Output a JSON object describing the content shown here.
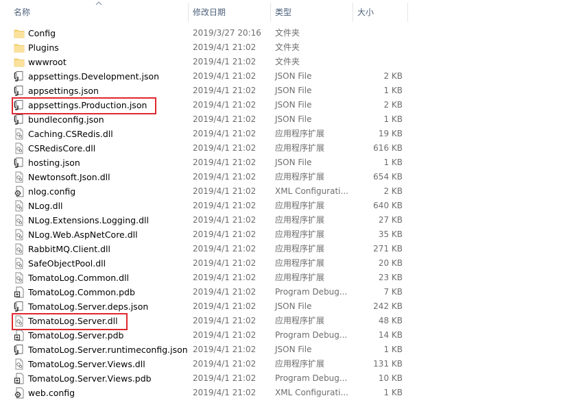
{
  "columns": {
    "name": "名称",
    "modified": "修改日期",
    "type": "类型",
    "size": "大小"
  },
  "sort": {
    "column": "name",
    "direction": "ascending",
    "icon": "sort-up-icon"
  },
  "files": [
    {
      "name": "Config",
      "modified": "2019/3/27 20:16",
      "type": "文件夹",
      "size": "",
      "icon": "folder-icon"
    },
    {
      "name": "Plugins",
      "modified": "2019/4/1 21:02",
      "type": "文件夹",
      "size": "",
      "icon": "folder-icon"
    },
    {
      "name": "wwwroot",
      "modified": "2019/4/1 21:02",
      "type": "文件夹",
      "size": "",
      "icon": "folder-icon"
    },
    {
      "name": "appsettings.Development.json",
      "modified": "2019/4/1 21:02",
      "type": "JSON File",
      "size": "2 KB",
      "icon": "json-file-icon"
    },
    {
      "name": "appsettings.json",
      "modified": "2019/4/1 21:02",
      "type": "JSON File",
      "size": "1 KB",
      "icon": "json-file-icon"
    },
    {
      "name": "appsettings.Production.json",
      "modified": "2019/4/1 21:02",
      "type": "JSON File",
      "size": "2 KB",
      "icon": "json-file-icon",
      "highlighted": true
    },
    {
      "name": "bundleconfig.json",
      "modified": "2019/4/1 21:02",
      "type": "JSON File",
      "size": "1 KB",
      "icon": "json-file-icon"
    },
    {
      "name": "Caching.CSRedis.dll",
      "modified": "2019/4/1 21:02",
      "type": "应用程序扩展",
      "size": "19 KB",
      "icon": "dll-file-icon"
    },
    {
      "name": "CSRedisCore.dll",
      "modified": "2019/4/1 21:02",
      "type": "应用程序扩展",
      "size": "616 KB",
      "icon": "dll-file-icon"
    },
    {
      "name": "hosting.json",
      "modified": "2019/4/1 21:02",
      "type": "JSON File",
      "size": "1 KB",
      "icon": "json-file-icon"
    },
    {
      "name": "Newtonsoft.Json.dll",
      "modified": "2019/4/1 21:02",
      "type": "应用程序扩展",
      "size": "654 KB",
      "icon": "dll-file-icon"
    },
    {
      "name": "nlog.config",
      "modified": "2019/4/1 21:02",
      "type": "XML Configurati...",
      "size": "2 KB",
      "icon": "config-file-icon"
    },
    {
      "name": "NLog.dll",
      "modified": "2019/4/1 21:02",
      "type": "应用程序扩展",
      "size": "640 KB",
      "icon": "dll-file-icon"
    },
    {
      "name": "NLog.Extensions.Logging.dll",
      "modified": "2019/4/1 21:02",
      "type": "应用程序扩展",
      "size": "27 KB",
      "icon": "dll-file-icon"
    },
    {
      "name": "NLog.Web.AspNetCore.dll",
      "modified": "2019/4/1 21:02",
      "type": "应用程序扩展",
      "size": "35 KB",
      "icon": "dll-file-icon"
    },
    {
      "name": "RabbitMQ.Client.dll",
      "modified": "2019/4/1 21:02",
      "type": "应用程序扩展",
      "size": "271 KB",
      "icon": "dll-file-icon"
    },
    {
      "name": "SafeObjectPool.dll",
      "modified": "2019/4/1 21:02",
      "type": "应用程序扩展",
      "size": "20 KB",
      "icon": "dll-file-icon"
    },
    {
      "name": "TomatoLog.Common.dll",
      "modified": "2019/4/1 21:02",
      "type": "应用程序扩展",
      "size": "23 KB",
      "icon": "dll-file-icon"
    },
    {
      "name": "TomatoLog.Common.pdb",
      "modified": "2019/4/1 21:02",
      "type": "Program Debug...",
      "size": "7 KB",
      "icon": "pdb-file-icon"
    },
    {
      "name": "TomatoLog.Server.deps.json",
      "modified": "2019/4/1 21:02",
      "type": "JSON File",
      "size": "242 KB",
      "icon": "json-file-icon"
    },
    {
      "name": "TomatoLog.Server.dll",
      "modified": "2019/4/1 21:02",
      "type": "应用程序扩展",
      "size": "48 KB",
      "icon": "dll-file-icon",
      "highlighted": true
    },
    {
      "name": "TomatoLog.Server.pdb",
      "modified": "2019/4/1 21:02",
      "type": "Program Debug...",
      "size": "14 KB",
      "icon": "pdb-file-icon"
    },
    {
      "name": "TomatoLog.Server.runtimeconfig.json",
      "modified": "2019/4/1 21:02",
      "type": "JSON File",
      "size": "1 KB",
      "icon": "json-file-icon"
    },
    {
      "name": "TomatoLog.Server.Views.dll",
      "modified": "2019/4/1 21:02",
      "type": "应用程序扩展",
      "size": "131 KB",
      "icon": "dll-file-icon"
    },
    {
      "name": "TomatoLog.Server.Views.pdb",
      "modified": "2019/4/1 21:02",
      "type": "Program Debug...",
      "size": "10 KB",
      "icon": "pdb-file-icon"
    },
    {
      "name": "web.config",
      "modified": "2019/4/1 21:02",
      "type": "XML Configurati...",
      "size": "1 KB",
      "icon": "config-file-icon"
    }
  ],
  "colors": {
    "folder": "#f8d775",
    "highlight_border": "#e0262d",
    "header_text": "#4c607a",
    "secondary_text": "#6d6d6d"
  }
}
